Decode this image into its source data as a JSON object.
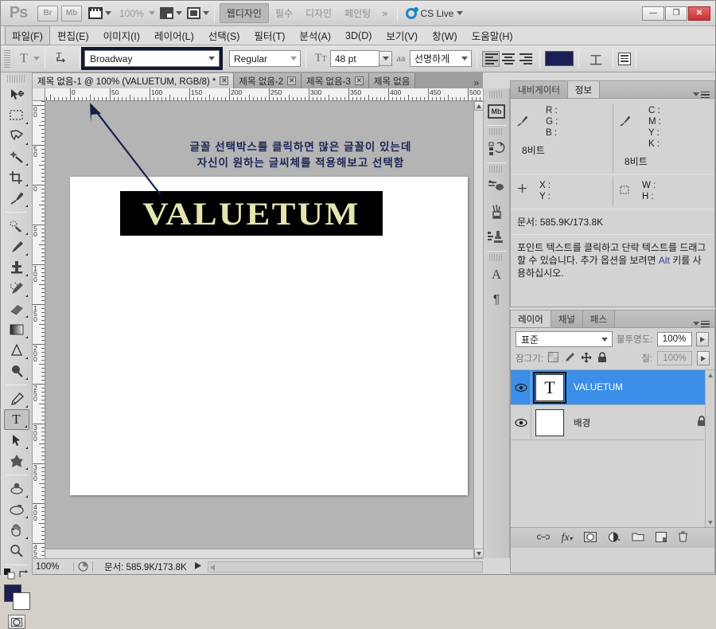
{
  "titlebar": {
    "app_logo": "Ps",
    "bridge_label": "Br",
    "minibridge_label": "Mb",
    "zoom_level": "100%",
    "workspaces": [
      {
        "label": "웹디자인",
        "active": true
      },
      {
        "label": "필수",
        "active": false
      },
      {
        "label": "디자인",
        "active": false
      },
      {
        "label": "페인팅",
        "active": false
      }
    ],
    "more_chevron": "»",
    "cs_live": "CS Live",
    "window_buttons": {
      "minimize": "—",
      "maximize": "❐",
      "close": "✕"
    }
  },
  "menubar": {
    "items": [
      {
        "label": "파일(F)",
        "selected": true
      },
      {
        "label": "편집(E)",
        "selected": false
      },
      {
        "label": "이미지(I)",
        "selected": false
      },
      {
        "label": "레이어(L)",
        "selected": false
      },
      {
        "label": "선택(S)",
        "selected": false
      },
      {
        "label": "필터(T)",
        "selected": false
      },
      {
        "label": "분석(A)",
        "selected": false
      },
      {
        "label": "3D(D)",
        "selected": false
      },
      {
        "label": "보기(V)",
        "selected": false
      },
      {
        "label": "창(W)",
        "selected": false
      },
      {
        "label": "도움말(H)",
        "selected": false
      }
    ]
  },
  "optionsbar": {
    "tool_glyph": "T",
    "orientation_icon": "toggle-text-orientation",
    "font_family": "Broadway",
    "font_style": "Regular",
    "font_size": "48 pt",
    "antialias_icon": "aa",
    "antialias_value": "선명하게",
    "align_left": "align-left",
    "align_center": "align-center",
    "align_right": "align-right",
    "text_color": "#1b1f55",
    "warp_glyph": "工",
    "panels_icon": "char-paragraph-panels"
  },
  "toolbar": {
    "tools": [
      {
        "name": "move-tool",
        "selected": false
      },
      {
        "name": "marquee-tool",
        "selected": false
      },
      {
        "name": "lasso-tool",
        "selected": false
      },
      {
        "name": "magic-wand-tool",
        "selected": false
      },
      {
        "name": "crop-tool",
        "selected": false
      },
      {
        "name": "eyedropper-tool",
        "selected": false
      },
      {
        "name": "healing-brush-tool",
        "selected": false
      },
      {
        "name": "brush-tool",
        "selected": false
      },
      {
        "name": "clone-stamp-tool",
        "selected": false
      },
      {
        "name": "history-brush-tool",
        "selected": false
      },
      {
        "name": "eraser-tool",
        "selected": false
      },
      {
        "name": "gradient-tool",
        "selected": false
      },
      {
        "name": "blur-tool",
        "selected": false
      },
      {
        "name": "dodge-tool",
        "selected": false
      },
      {
        "name": "pen-tool",
        "selected": false
      },
      {
        "name": "type-tool",
        "selected": true,
        "glyph": "T"
      },
      {
        "name": "path-selection-tool",
        "selected": false
      },
      {
        "name": "shape-tool",
        "selected": false
      },
      {
        "name": "rotate-3d-tool",
        "selected": false
      },
      {
        "name": "orbit-3d-tool",
        "selected": false
      },
      {
        "name": "hand-tool",
        "selected": false
      },
      {
        "name": "zoom-tool",
        "selected": false
      }
    ],
    "foreground_color": "#1b1f55",
    "background_color": "#ffffff"
  },
  "document_tabs": [
    {
      "label": "제목 없음-1 @ 100% (VALUETUM, RGB/8) *",
      "active": true,
      "close": "✕"
    },
    {
      "label": "제목 없음-2",
      "active": false,
      "close": "✕"
    },
    {
      "label": "제목 없음-3",
      "active": false,
      "close": "✕"
    },
    {
      "label": "제목 없음",
      "active": false,
      "close": ""
    }
  ],
  "tabs_overflow": "»",
  "canvas": {
    "ruler_h_labels": [
      "0",
      "50",
      "100",
      "150",
      "200",
      "250",
      "300",
      "350",
      "400",
      "450",
      "500"
    ],
    "ruler_v_labels": [
      "00",
      "50",
      "0",
      "50",
      "100",
      "150",
      "200",
      "250",
      "300",
      "350",
      "400",
      "450"
    ],
    "annotation": "글꼴 선택박스를 클릭하면 많은 글꼴이 있는데\n자신이 원하는 글씨체를 적용해보고 선택함",
    "annotation_color": "#1b2555",
    "artwork_text": "VALUETUM",
    "artwork_text_color": "#e4e6ae",
    "artwork_bg_color": "#000000"
  },
  "statusbar": {
    "zoom": "100%",
    "doc_info": "문서: 585.9K/173.8K",
    "arrow": "▶"
  },
  "dockstrip": {
    "icons": [
      {
        "name": "mini-bridge-icon",
        "label": "Mb"
      },
      {
        "name": "history-icon",
        "label": ""
      },
      {
        "name": "brush-presets-icon",
        "label": ""
      },
      {
        "name": "brush-icon",
        "label": ""
      },
      {
        "name": "clone-source-icon",
        "label": ""
      },
      {
        "name": "character-panel-icon",
        "label": "A"
      },
      {
        "name": "paragraph-panel-icon",
        "label": "¶"
      }
    ]
  },
  "info_panel": {
    "tabs": [
      {
        "label": "내비게이터",
        "active": false
      },
      {
        "label": "정보",
        "active": true
      }
    ],
    "left_channels": [
      "R :",
      "G :",
      "B :"
    ],
    "right_channels": [
      "C :",
      "M :",
      "Y :",
      "K :"
    ],
    "left_bits": "8비트",
    "right_bits": "8비트",
    "position_labels": [
      "X :",
      "Y :"
    ],
    "size_labels": [
      "W :",
      "H :"
    ],
    "doc_size": "문서: 585.9K/173.8K",
    "hint_text": "포인트 텍스트를 클릭하고 단락 텍스트를 드래그할 수 있습니다. 추가 옵션을 보려면 ",
    "hint_key": "Alt",
    "hint_tail": " 키를 사용하십시오."
  },
  "layers_panel": {
    "tabs": [
      {
        "label": "레이어",
        "active": true
      },
      {
        "label": "채널",
        "active": false
      },
      {
        "label": "패스",
        "active": false
      }
    ],
    "blend_mode": "표준",
    "opacity_label": "불투명도:",
    "opacity_value": "100%",
    "lock_label": "잠그기:",
    "fill_label": "칠:",
    "fill_value": "100%",
    "lock_icons": [
      "lock-transparent-icon",
      "lock-pixels-icon",
      "lock-position-icon",
      "lock-all-icon"
    ],
    "layers": [
      {
        "name": "VALUETUM",
        "selected": true,
        "thumb_glyph": "T",
        "visible": true,
        "locked": false
      },
      {
        "name": "배경",
        "selected": false,
        "thumb_glyph": "",
        "visible": true,
        "locked": true
      }
    ],
    "bottom_buttons": [
      {
        "name": "link-layers-icon",
        "glyph": "⚭"
      },
      {
        "name": "layer-style-fx-icon",
        "glyph": "fx"
      },
      {
        "name": "layer-mask-icon",
        "glyph": "◻"
      },
      {
        "name": "adjustment-layer-icon",
        "glyph": "◐"
      },
      {
        "name": "new-group-icon",
        "glyph": "▭"
      },
      {
        "name": "new-layer-icon",
        "glyph": "▣"
      },
      {
        "name": "delete-layer-icon",
        "glyph": "🗑"
      }
    ]
  }
}
